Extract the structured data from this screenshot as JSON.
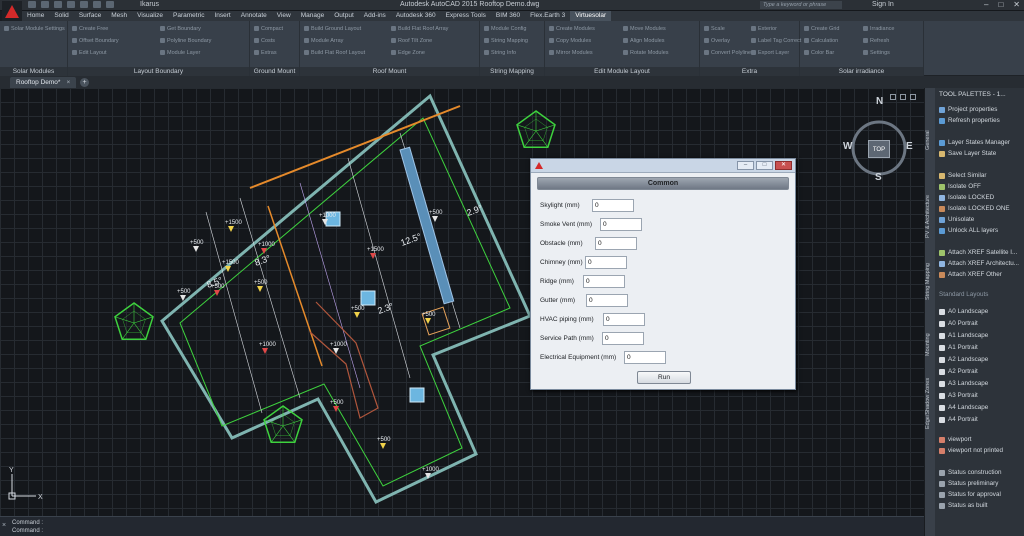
{
  "titlebar": {
    "workspace": "Ikarus",
    "title": "Autodesk AutoCAD 2015    Rooftop Demo.dwg",
    "search_placeholder": "Type a keyword or phrase",
    "signin": "Sign In"
  },
  "menu_tabs": [
    "Home",
    "Solid",
    "Surface",
    "Mesh",
    "Visualize",
    "Parametric",
    "Insert",
    "Annotate",
    "View",
    "Manage",
    "Output",
    "Add-ins",
    "Autodesk 360",
    "Express Tools",
    "BIM 360",
    "Flex.Earth 3",
    "Virtuesolar"
  ],
  "active_tab": "Virtuesolar",
  "ribbon": {
    "panels": [
      {
        "label": "Solar Modules",
        "buttons": [
          "Solar Module Settings"
        ]
      },
      {
        "label": "Layout Boundary",
        "buttons": [
          "Create Free",
          "Offset Boundary",
          "Edit Layout",
          "Get Boundary",
          "Polyline Boundary",
          "Module Layer"
        ]
      },
      {
        "label": "Ground Mount",
        "buttons": [
          "Compact",
          "Costs",
          "Extras"
        ]
      },
      {
        "label": "Roof Mount",
        "buttons": [
          "Build Ground Layout",
          "Module Array",
          "Build Flat Roof Layout",
          "Build Flat Roof Array",
          "Roof Tilt Zone",
          "Edge Zone"
        ]
      },
      {
        "label": "String Mapping",
        "buttons": [
          "Module Config",
          "String Mapping",
          "String Info"
        ]
      },
      {
        "label": "Edit Module Layout",
        "buttons": [
          "Create Modules",
          "Copy Modules",
          "Mirror Modules",
          "Move Modules",
          "Align Modules",
          "Rotate Modules"
        ]
      },
      {
        "label": "Extra",
        "buttons": [
          "Scale",
          "Overlay",
          "Convert Polyline",
          "Exterior",
          "Label Tag Correct",
          "Export Layer"
        ]
      },
      {
        "label": "Solar irradiance",
        "buttons": [
          "Create Grid",
          "Calculation",
          "Color Bar",
          "Irradiance",
          "Refresh",
          "Settings"
        ]
      }
    ]
  },
  "document_tab": "Rooftop Demo*",
  "viewcube": {
    "top": "TOP",
    "north": "N",
    "south": "S",
    "east": "E",
    "west": "W"
  },
  "drawing": {
    "markers": [
      "+1500",
      "+500",
      "+1000",
      "+1500",
      "+500",
      "+500",
      "+500",
      "+1000",
      "+1500",
      "+500",
      "+1000",
      "+1000",
      "+500",
      "+500",
      "+500",
      "+500",
      "+1000"
    ],
    "slope_labels": [
      "2.9°",
      "12.5°",
      "8.3°",
      "8.5°",
      "2.3°"
    ]
  },
  "dialog": {
    "header": "Common",
    "fields": [
      {
        "label": "Skylight (mm)",
        "value": "0"
      },
      {
        "label": "Smoke Vent (mm)",
        "value": "0"
      },
      {
        "label": "Obstacle (mm)",
        "value": "0"
      },
      {
        "label": "Chimney (mm)",
        "value": "0"
      },
      {
        "label": "Ridge (mm)",
        "value": "0"
      },
      {
        "label": "Gutter (mm)",
        "value": "0"
      },
      {
        "label": "HVAC piping (mm)",
        "value": "0"
      },
      {
        "label": "Service Path (mm)",
        "value": "0"
      },
      {
        "label": "Electrical Equipment (mm)",
        "value": "0"
      }
    ],
    "run_label": "Run"
  },
  "tool_palette": {
    "title": "TOOL PALETTES - 1...",
    "side_tabs": [
      "General",
      "PV & Architecture",
      "String Mapping",
      "Mounting",
      "Edge/Shadow Zones"
    ],
    "groups": [
      {
        "items": [
          "Project properties",
          "Refresh properties"
        ]
      },
      {
        "items": [
          "Layer States Manager",
          "Save Layer State"
        ]
      },
      {
        "items": [
          "Select Similar",
          "Isolate OFF",
          "Isolate LOCKED",
          "Isolate LOCKED ONE",
          "Unisolate",
          "Unlock ALL layers"
        ]
      },
      {
        "items": [
          "Attach XREF Satellite I...",
          "Attach XREF Architectu...",
          "Attach XREF Other"
        ]
      }
    ],
    "layouts_section": "Standard Layouts",
    "layouts": [
      "A0 Landscape",
      "A0 Portrait",
      "A1 Landscape",
      "A1 Portrait",
      "A2 Landscape",
      "A2 Portrait",
      "A3 Landscape",
      "A3 Portrait",
      "A4 Landscape",
      "A4 Portrait"
    ],
    "viewports": [
      "viewport",
      "viewport not printed"
    ],
    "statuses": [
      "Status construction",
      "Status preliminary",
      "Status for approval",
      "Status as built"
    ]
  },
  "command": {
    "line1": "Command :",
    "line2": "Command :"
  },
  "axes": {
    "x": "X",
    "y": "Y"
  }
}
